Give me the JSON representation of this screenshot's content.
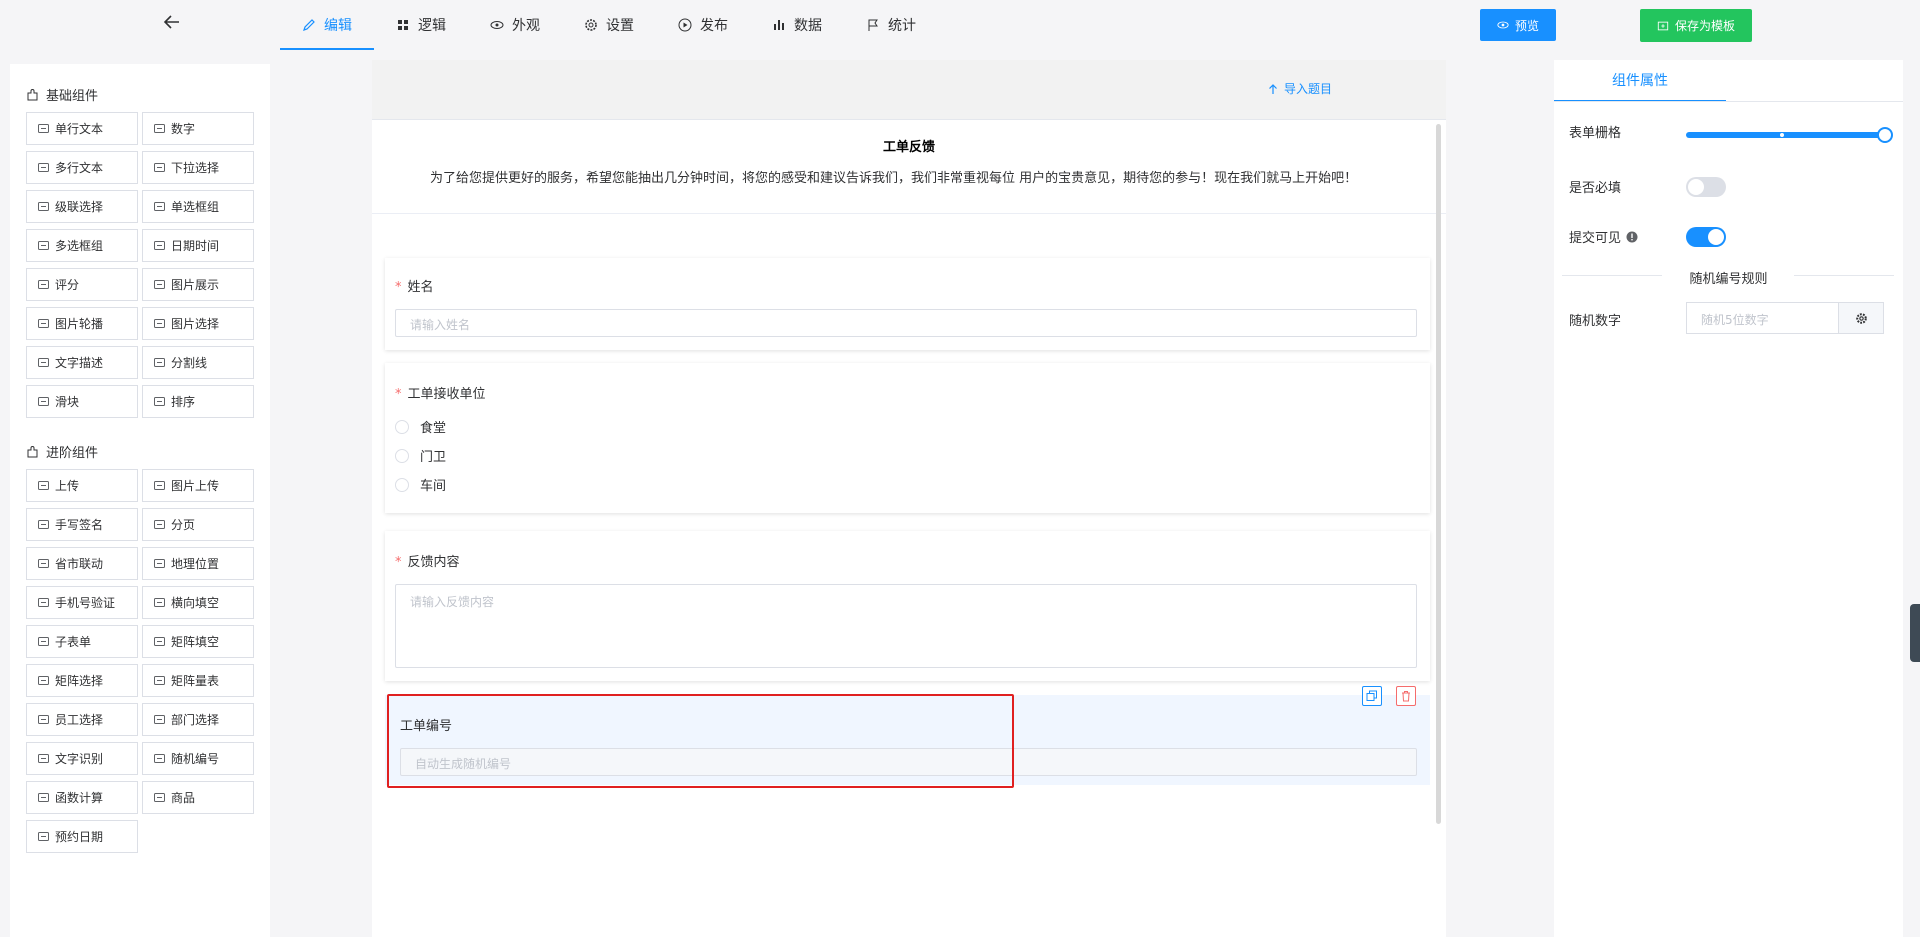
{
  "nav": {
    "tabs": [
      {
        "label": "编辑",
        "icon": "edit-icon"
      },
      {
        "label": "逻辑",
        "icon": "grid-icon"
      },
      {
        "label": "外观",
        "icon": "eye-icon"
      },
      {
        "label": "设置",
        "icon": "gear-icon"
      },
      {
        "label": "发布",
        "icon": "play-icon"
      },
      {
        "label": "数据",
        "icon": "bar-chart-icon"
      },
      {
        "label": "统计",
        "icon": "flag-icon"
      }
    ],
    "active_tab": "编辑",
    "preview_label": "预览",
    "save_template_label": "保存为模板"
  },
  "left_panel": {
    "basic_title": "基础组件",
    "basic_items": [
      "单行文本",
      "数字",
      "多行文本",
      "下拉选择",
      "级联选择",
      "单选框组",
      "多选框组",
      "日期时间",
      "评分",
      "图片展示",
      "图片轮播",
      "图片选择",
      "文字描述",
      "分割线",
      "滑块",
      "排序"
    ],
    "advanced_title": "进阶组件",
    "advanced_items": [
      "上传",
      "图片上传",
      "手写签名",
      "分页",
      "省市联动",
      "地理位置",
      "手机号验证",
      "横向填空",
      "子表单",
      "矩阵填空",
      "矩阵选择",
      "矩阵量表",
      "员工选择",
      "部门选择",
      "文字识别",
      "随机编号",
      "函数计算",
      "商品",
      "预约日期"
    ]
  },
  "canvas": {
    "import_label": "导入题目",
    "form_title": "工单反馈",
    "form_desc": "为了给您提供更好的服务，希望您能抽出几分钟时间，将您的感受和建议告诉我们，我们非常重视每位 用户的宝贵意见，期待您的参与！现在我们就马上开始吧！",
    "q1": {
      "label": "姓名",
      "placeholder": "请输入姓名",
      "required_mark": "*"
    },
    "q2": {
      "label": "工单接收单位",
      "required_mark": "*",
      "options": [
        "食堂",
        "门卫",
        "车间"
      ]
    },
    "q3": {
      "label": "反馈内容",
      "placeholder": "请输入反馈内容",
      "required_mark": "*"
    },
    "q4": {
      "label": "工单编号",
      "placeholder": "自动生成随机编号"
    }
  },
  "right_panel": {
    "tab_label": "组件属性",
    "grid_label": "表单栅格",
    "grid_value_fraction": 1.0,
    "required_label": "是否必填",
    "required_on": false,
    "visible_label": "提交可见",
    "visible_on": true,
    "rule_title": "随机编号规则",
    "rand_label": "随机数字",
    "rand_placeholder": "随机5位数字"
  },
  "colors": {
    "accent": "#1890ff",
    "save": "#23c55e",
    "danger": "#f56c6c",
    "highlight": "#e02020"
  }
}
